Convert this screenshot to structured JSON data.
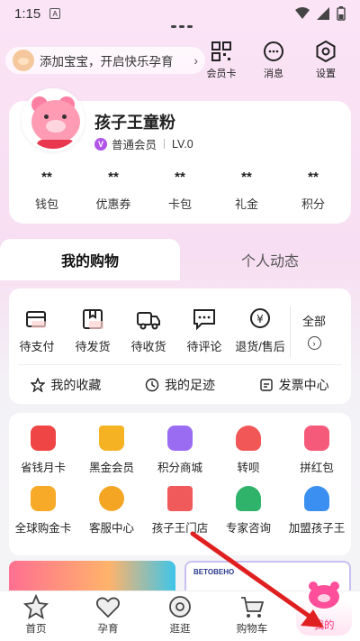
{
  "status_bar": {
    "time": "1:15",
    "a_icon": "A"
  },
  "header": {
    "baby_prompt": "添加宝宝，开启快乐孕育",
    "icons": [
      {
        "name": "member-card",
        "label": "会员卡"
      },
      {
        "name": "messages",
        "label": "消息"
      },
      {
        "name": "settings",
        "label": "设置"
      }
    ]
  },
  "profile": {
    "name": "孩子王童粉",
    "member_badge": "V",
    "member_type": "普通会员",
    "level": "LV.0",
    "stats": [
      {
        "value": "**",
        "label": "钱包"
      },
      {
        "value": "**",
        "label": "优惠券"
      },
      {
        "value": "**",
        "label": "卡包"
      },
      {
        "value": "**",
        "label": "礼金"
      },
      {
        "value": "**",
        "label": "积分"
      }
    ]
  },
  "tabs": {
    "active": "我的购物",
    "inactive": "个人动态"
  },
  "orders": {
    "items": [
      "待支付",
      "待发货",
      "待收货",
      "待评论",
      "退货/售后"
    ],
    "all_label": "全部",
    "quick": [
      "我的收藏",
      "我的足迹",
      "发票中心"
    ]
  },
  "services": [
    {
      "label": "省钱月卡",
      "color": "#f04545"
    },
    {
      "label": "黑金会员",
      "color": "#f5b324"
    },
    {
      "label": "积分商城",
      "color": "#9a6cf2"
    },
    {
      "label": "转呗",
      "color": "#f25757"
    },
    {
      "label": "拼红包",
      "color": "#f55a7a"
    },
    {
      "label": "全球购金卡",
      "color": "#f7a928"
    },
    {
      "label": "客服中心",
      "color": "#f5a524"
    },
    {
      "label": "孩子王门店",
      "color": "#f05a5a"
    },
    {
      "label": "专家咨询",
      "color": "#2fb36b"
    },
    {
      "label": "加盟孩子王",
      "color": "#3a8ff0"
    }
  ],
  "banners": {
    "right_brand": "BETOBEHO"
  },
  "bottom_nav": {
    "items": [
      {
        "label": "首页"
      },
      {
        "label": "孕育"
      },
      {
        "label": "逛逛"
      },
      {
        "label": "购物车"
      },
      {
        "label": "我的"
      }
    ],
    "active_color": "#ff2f7d"
  }
}
